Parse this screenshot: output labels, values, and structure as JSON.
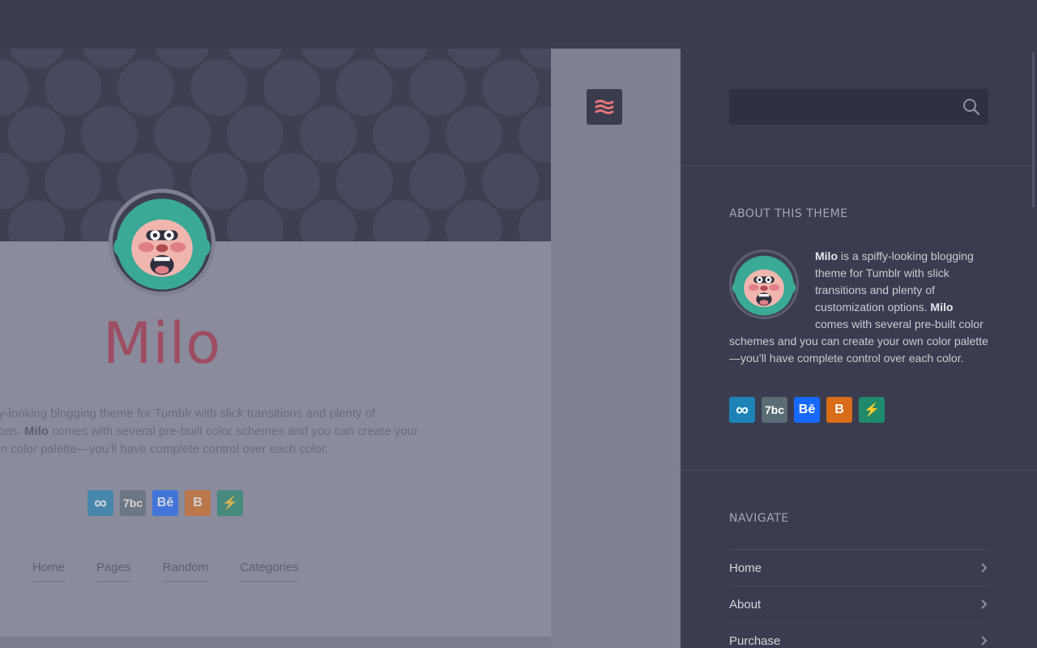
{
  "colors": {
    "background": "#3b3c4f",
    "page_dim": "#8a8b9c",
    "title": "#9e4e62",
    "accent_icon": "#e8777a"
  },
  "page": {
    "title": "Milo",
    "description_lines": [
      "ffy-looking blogging theme for Tumblr with slick transitions and plenty of",
      "tions. ",
      " comes with several pre-built color schemes and you can create your",
      "wn color palette—you’ll have complete control over each color."
    ],
    "description_bold": "Milo",
    "social": [
      {
        "icon": "infinity-icon",
        "color": "#1d83b7",
        "glyph": "∞"
      },
      {
        "icon": "vimeo-icon",
        "color": "#5a6c74",
        "glyph": "7bc"
      },
      {
        "icon": "behance-icon",
        "color": "#1769ff",
        "glyph": "Bē"
      },
      {
        "icon": "blogger-icon",
        "color": "#d86c18",
        "glyph": "B"
      },
      {
        "icon": "lightning-icon",
        "color": "#1f8a6c",
        "glyph": "⚡"
      }
    ],
    "nav": [
      "Home",
      "Pages",
      "Random",
      "Categories"
    ]
  },
  "menu_toggle": {
    "icon": "menu-icon"
  },
  "sidebar": {
    "search": {
      "placeholder": "",
      "value": "",
      "icon": "search-icon"
    },
    "about": {
      "title": "ABOUT THIS THEME",
      "name": "Milo",
      "text_1": " is a spiffy-looking blogging theme for Tumblr with slick transitions and plenty of customization options. ",
      "text_2": " comes with several pre-built color schemes and you can create your own color palette—you’ll have complete control over each color."
    },
    "navigate": {
      "title": "NAVIGATE",
      "items": [
        "Home",
        "About",
        "Purchase"
      ]
    }
  }
}
